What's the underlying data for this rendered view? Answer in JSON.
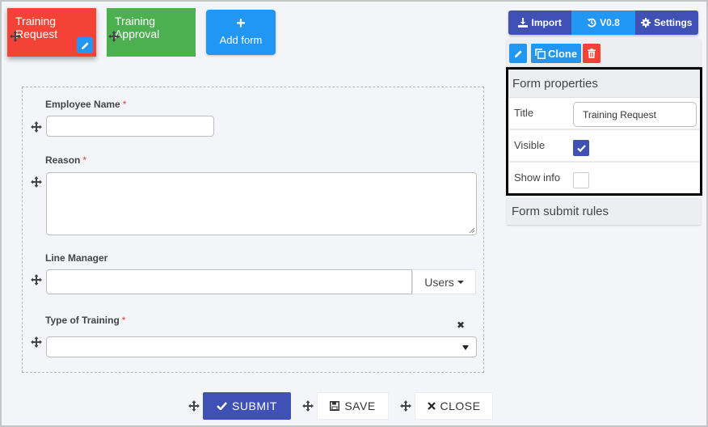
{
  "forms": {
    "tabs": [
      {
        "label": "Training Request",
        "color": "#f44336",
        "active": true
      },
      {
        "label": "Training Approval",
        "color": "#4caf50",
        "active": false
      }
    ],
    "add_form_label": "Add form",
    "add_form_icon": "+"
  },
  "form": {
    "fields": [
      {
        "label": "Employee Name",
        "required": true,
        "type": "text",
        "value": ""
      },
      {
        "label": "Reason",
        "required": true,
        "type": "textarea",
        "value": ""
      },
      {
        "label": "Line Manager",
        "required": false,
        "type": "user-picker",
        "value": "",
        "button_label": "Users"
      },
      {
        "label": "Type of Training",
        "required": true,
        "type": "select",
        "value": ""
      }
    ],
    "required_marker": "*",
    "clear_icon": "✖"
  },
  "actions": {
    "submit": "SUBMIT",
    "save": "SAVE",
    "close": "CLOSE"
  },
  "toolbar": {
    "import": "Import",
    "version": "V0.8",
    "settings": "Settings"
  },
  "form_actions": {
    "clone": "Clone"
  },
  "properties": {
    "heading": "Form properties",
    "title_label": "Title",
    "title_value": "Training Request",
    "visible_label": "Visible",
    "visible_checked": true,
    "show_info_label": "Show info",
    "show_info_checked": false
  },
  "submit_rules": {
    "heading": "Form submit rules"
  },
  "colors": {
    "primary": "#3f51b5",
    "info": "#2196f3",
    "danger": "#f44336",
    "success": "#4caf50"
  }
}
